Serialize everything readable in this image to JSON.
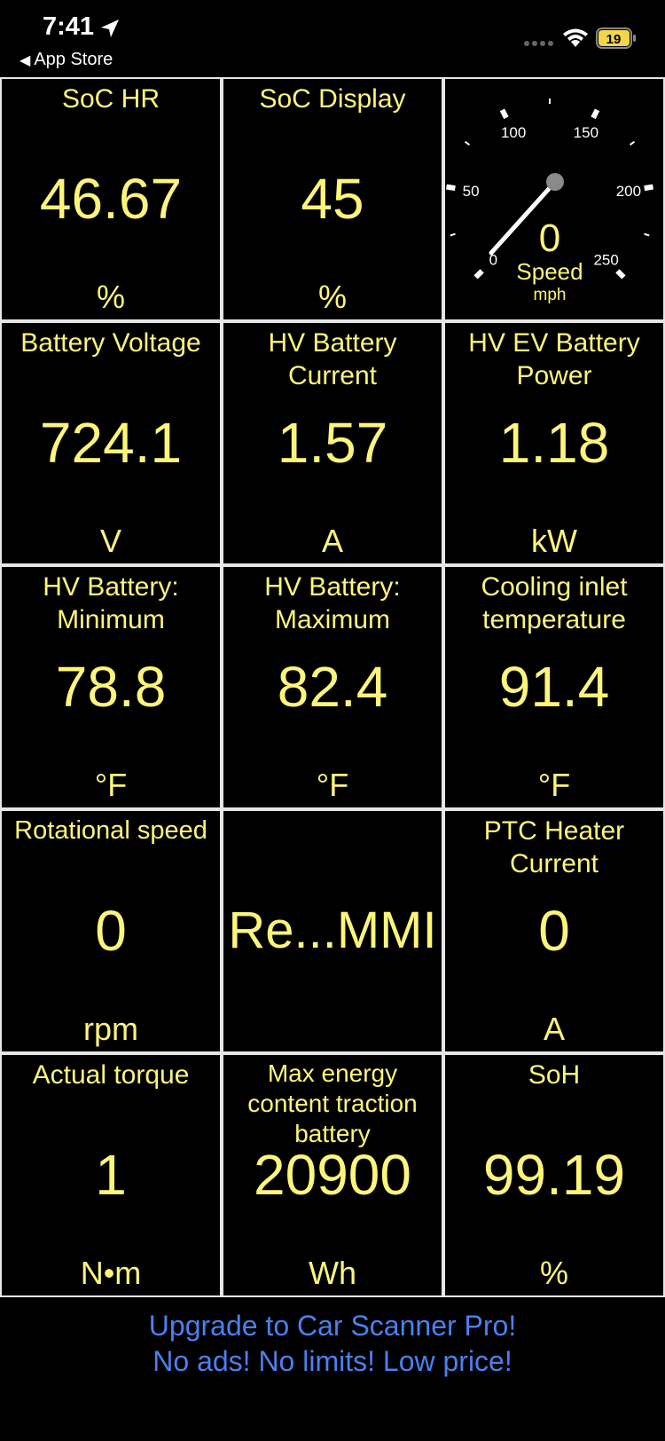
{
  "status_bar": {
    "time": "7:41",
    "back_label": "App Store",
    "battery_level": "19"
  },
  "tiles": [
    {
      "title": "SoC HR",
      "value": "46.67",
      "unit": "%"
    },
    {
      "title": "SoC Display",
      "value": "45",
      "unit": "%"
    },
    {
      "gauge": true
    },
    {
      "title": "Battery Voltage",
      "value": "724.1",
      "unit": "V"
    },
    {
      "title": "HV Battery\nCurrent",
      "value": "1.57",
      "unit": "A"
    },
    {
      "title": "HV EV Battery\nPower",
      "value": "1.18",
      "unit": "kW"
    },
    {
      "title": "HV Battery:\nMinimum",
      "value": "78.8",
      "unit": "°F"
    },
    {
      "title": "HV Battery:\nMaximum",
      "value": "82.4",
      "unit": "°F"
    },
    {
      "title": "Cooling inlet\ntemperature",
      "value": "91.4",
      "unit": "°F"
    },
    {
      "title": "Rotational speed",
      "value": "0",
      "unit": "rpm"
    },
    {
      "title": "",
      "value": "Re...MMI",
      "unit": ""
    },
    {
      "title": "PTC Heater\nCurrent",
      "value": "0",
      "unit": "A"
    },
    {
      "title": "Actual torque",
      "value": "1",
      "unit": "N•m"
    },
    {
      "title": "Max energy\ncontent traction\nbattery",
      "value": "20900",
      "unit": "Wh"
    },
    {
      "title": "SoH",
      "value": "99.19",
      "unit": "%"
    }
  ],
  "gauge": {
    "value": "0",
    "label": "Speed",
    "unit": "mph",
    "tick_labels": [
      "0",
      "50",
      "100",
      "150",
      "200",
      "250"
    ]
  },
  "promo": {
    "line1": "Upgrade to Car Scanner Pro!",
    "line2": "No ads! No limits! Low price!"
  },
  "colors": {
    "value_text": "#fdf57a",
    "promo_text": "#4a80f0",
    "grid_lines": "#e6e6e6",
    "background": "#000000"
  }
}
